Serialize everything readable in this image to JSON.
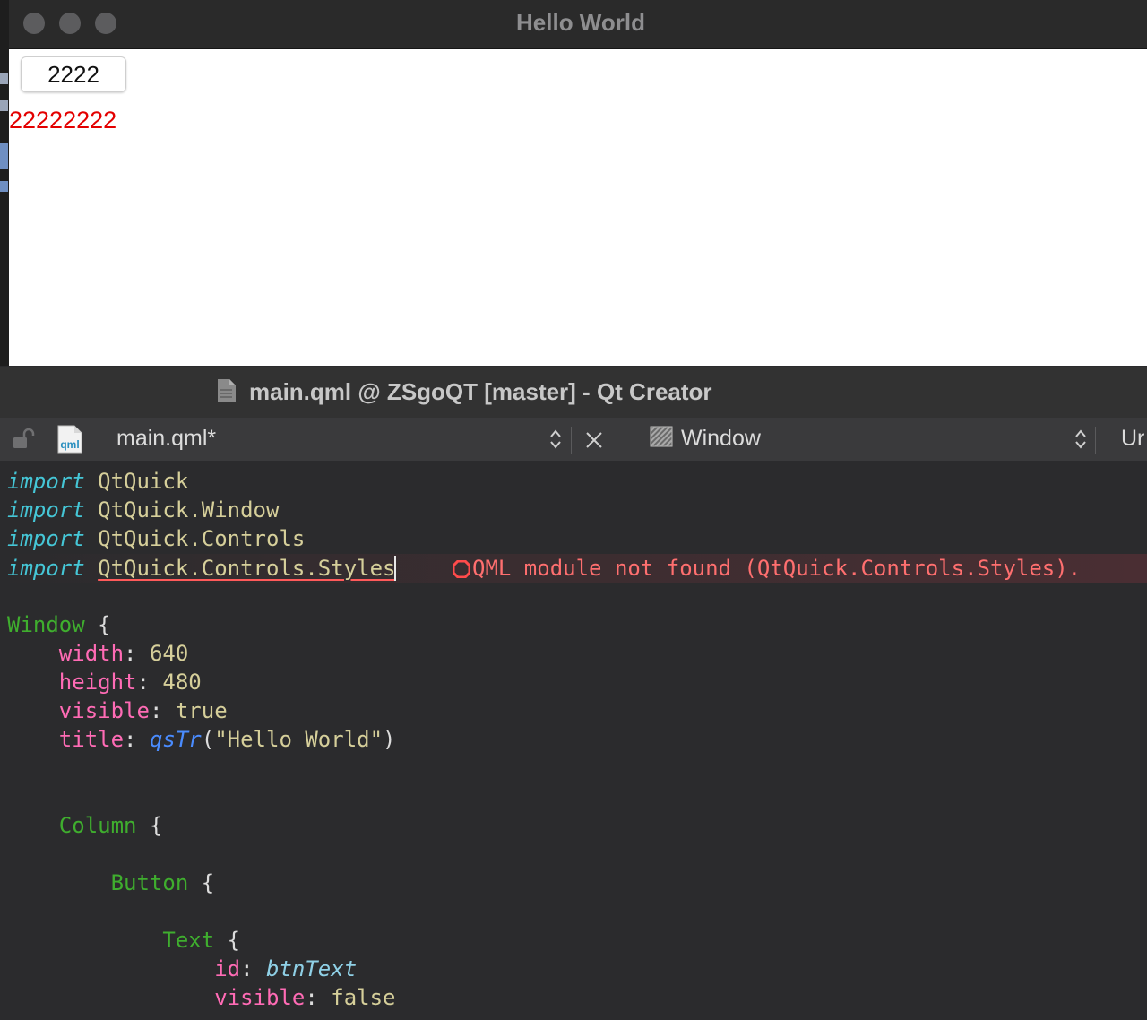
{
  "app_window": {
    "title": "Hello World",
    "button_label": "2222",
    "red_text": "22222222"
  },
  "creator": {
    "window_title": "main.qml @ ZSgoQT [master] - Qt Creator",
    "toolbar": {
      "file_name": "main.qml*",
      "file_icon_text": "qml",
      "type_name": "Window",
      "truncated_label": "Ur"
    },
    "error": {
      "message": "QML module not found (QtQuick.Controls.Styles)."
    },
    "code": {
      "import_kw": "import",
      "lines": {
        "l1_module": "QtQuick",
        "l2_module": "QtQuick.Window",
        "l3_module": "QtQuick.Controls",
        "l4_module": "QtQuick.Controls.Styles",
        "window_type": "Window",
        "width_prop": "width",
        "width_val": "640",
        "height_prop": "height",
        "height_val": "480",
        "visible_prop": "visible",
        "visible_val": "true",
        "title_prop": "title",
        "title_func": "qsTr",
        "title_str": "\"Hello World\"",
        "column_type": "Column",
        "button_type": "Button",
        "text_type": "Text",
        "id_prop": "id",
        "id_val": "btnText",
        "visible2_prop": "visible",
        "visible2_val": "false"
      }
    }
  },
  "colors": {
    "editor_bg": "#2b2b2d",
    "import_keyword": "#45c6d6",
    "type_name": "#3fae2e",
    "property_name": "#ff6bb5",
    "error_text": "#ff6f6f",
    "red_label": "#e30000"
  }
}
